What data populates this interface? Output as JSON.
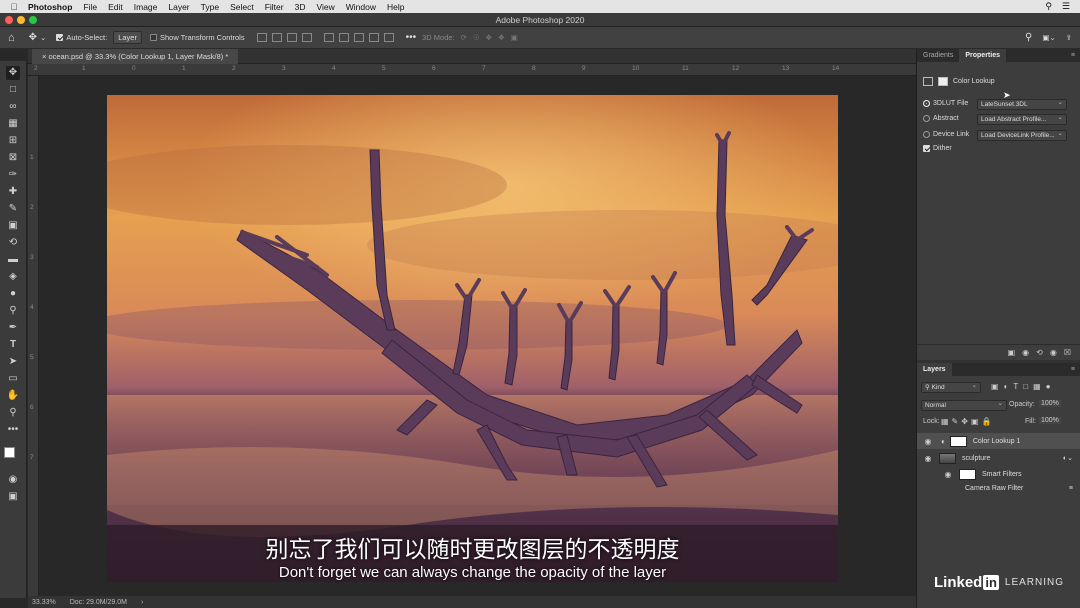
{
  "menubar": {
    "app_name": "Photoshop",
    "items": [
      "File",
      "Edit",
      "Image",
      "Layer",
      "Type",
      "Select",
      "Filter",
      "3D",
      "View",
      "Window",
      "Help"
    ]
  },
  "window": {
    "title": "Adobe Photoshop 2020"
  },
  "options_bar": {
    "auto_select_label": "Auto-Select:",
    "auto_select_checked": true,
    "auto_select_value": "Layer",
    "show_transform_label": "Show Transform Controls",
    "mode_3d_label": "3D Mode:"
  },
  "document": {
    "tab_label": "ocean.psd @ 33.3% (Color Lookup 1, Layer Mask/8) *",
    "ruler_top": [
      "2",
      "1",
      "0",
      "1",
      "2",
      "3",
      "4",
      "5",
      "6",
      "7",
      "8",
      "9",
      "10",
      "11",
      "12",
      "13",
      "14"
    ],
    "ruler_left": [
      "1",
      "2",
      "3",
      "4",
      "5",
      "6",
      "7"
    ]
  },
  "status": {
    "zoom": "33.33%",
    "doc_info": "Doc: 29.0M/29.0M"
  },
  "properties_panel": {
    "tabs": [
      "Gradients",
      "Properties"
    ],
    "active_tab": "Properties",
    "header_label": "Color Lookup",
    "options": [
      {
        "label": "3DLUT File",
        "value": "LateSunset.3DL",
        "selected": true
      },
      {
        "label": "Abstract",
        "value": "Load Abstract Profile...",
        "selected": false
      },
      {
        "label": "Device Link",
        "value": "Load DeviceLink Profile...",
        "selected": false
      }
    ],
    "dither_label": "Dither",
    "dither_checked": true
  },
  "layers_panel": {
    "tab_label": "Layers",
    "filter_kind": "Kind",
    "blend_mode": "Normal",
    "opacity_label": "Opacity:",
    "opacity_value": "100%",
    "lock_label": "Lock:",
    "fill_label": "Fill:",
    "fill_value": "100%",
    "layers": [
      {
        "name": "Color Lookup 1",
        "selected": true
      },
      {
        "name": "sculpture",
        "selected": false
      },
      {
        "name": "Smart Filters",
        "selected": false
      },
      {
        "name": "Camera Raw Filter",
        "selected": false
      }
    ]
  },
  "subtitles": {
    "zh": "别忘了我们可以随时更改图层的不透明度",
    "en": "Don't forget we can always change the opacity of the layer"
  },
  "watermark": {
    "brand": "Linked",
    "in": "in",
    "learning": "LEARNING"
  },
  "colors": {
    "ui_dark": "#323232",
    "sky_top": "#e8a04a",
    "sea": "#4a2c44"
  }
}
